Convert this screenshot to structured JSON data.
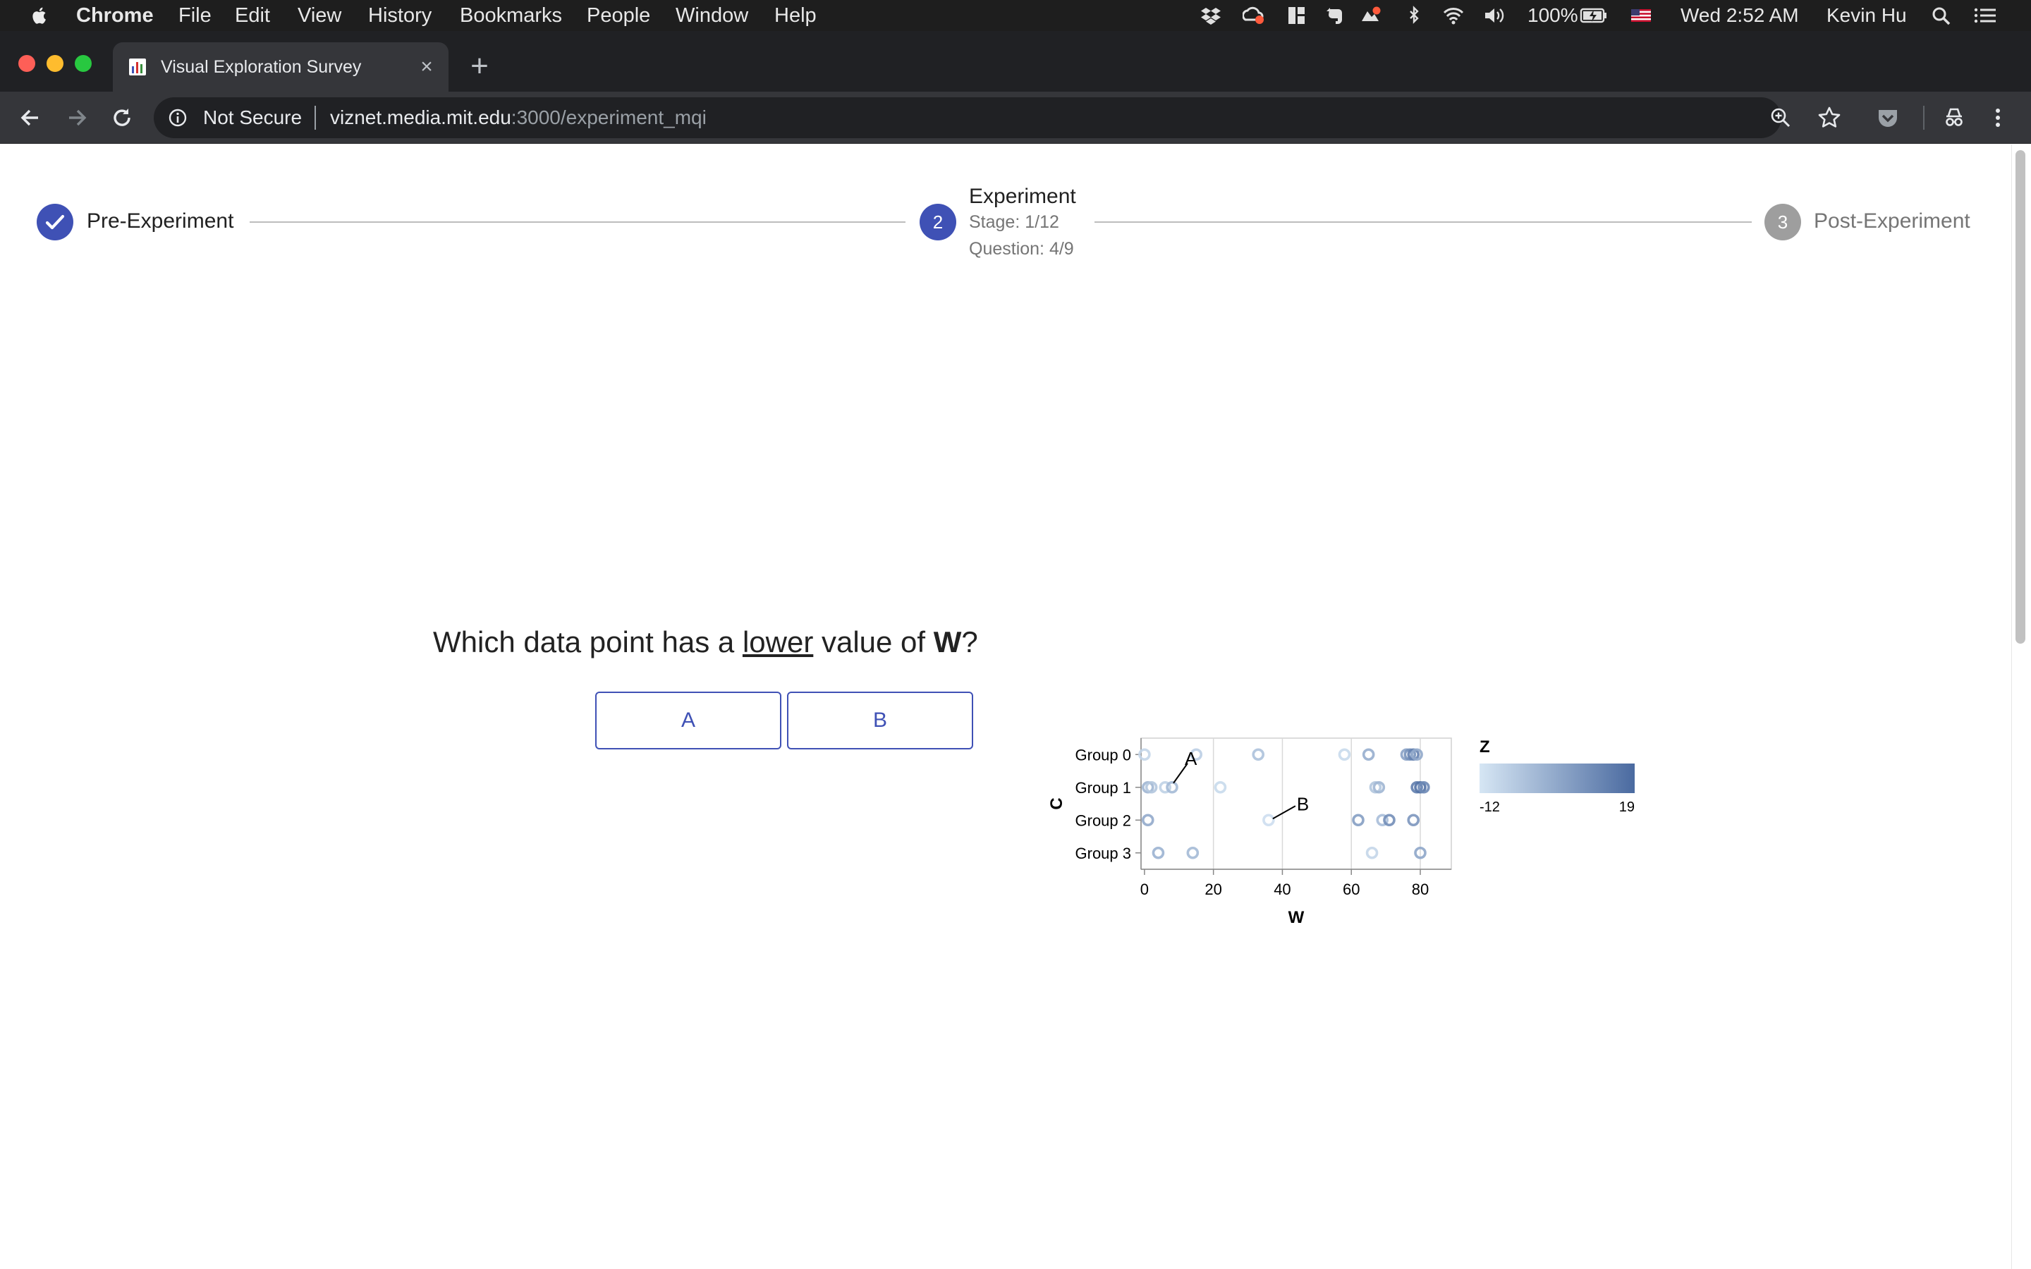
{
  "menubar": {
    "app": "Chrome",
    "items": [
      "File",
      "Edit",
      "View",
      "History",
      "Bookmarks",
      "People",
      "Window",
      "Help"
    ],
    "battery": "100%",
    "datetime": "Wed 2:52 AM",
    "user": "Kevin Hu"
  },
  "browser": {
    "tab_title": "Visual Exploration Survey",
    "security_label": "Not Secure",
    "url_host": "viznet.media.mit.edu",
    "url_path": ":3000/experiment_mqi"
  },
  "stepper": {
    "step1": {
      "label": "Pre-Experiment",
      "state": "completed"
    },
    "step2": {
      "number": "2",
      "label": "Experiment",
      "stage": "Stage: 1/12",
      "question": "Question: 4/9",
      "state": "active"
    },
    "step3": {
      "number": "3",
      "label": "Post-Experiment",
      "state": "pending"
    }
  },
  "question": {
    "prefix": "Which data point has a ",
    "emphasis": "lower",
    "middle": " value of ",
    "variable": "W",
    "suffix": "?",
    "options": [
      "A",
      "B"
    ]
  },
  "colors": {
    "accent": "#3f51b5",
    "color_low": "#d6e6f4",
    "color_high": "#4a6aa0"
  },
  "chart_data": {
    "type": "scatter",
    "xlabel": "W",
    "ylabel": "C",
    "xlim": [
      -1,
      89
    ],
    "xticks": [
      0,
      20,
      40,
      60,
      80
    ],
    "categories": [
      "Group 0",
      "Group 1",
      "Group 2",
      "Group 3"
    ],
    "color_legend": {
      "title": "Z",
      "min_label": "-12",
      "max_label": "19",
      "min": -12,
      "max": 19
    },
    "grid": "vertical",
    "points": [
      {
        "x": 0,
        "c": 0,
        "z": -8
      },
      {
        "x": 15,
        "c": 0,
        "z": -6
      },
      {
        "x": 33,
        "c": 0,
        "z": -3
      },
      {
        "x": 58,
        "c": 0,
        "z": -9
      },
      {
        "x": 65,
        "c": 0,
        "z": 2
      },
      {
        "x": 76,
        "c": 0,
        "z": 5
      },
      {
        "x": 77,
        "c": 0,
        "z": 9
      },
      {
        "x": 78,
        "c": 0,
        "z": 13
      },
      {
        "x": 79,
        "c": 0,
        "z": 3
      },
      {
        "x": 1,
        "c": 1,
        "z": 0
      },
      {
        "x": 2,
        "c": 1,
        "z": -4
      },
      {
        "x": 6,
        "c": 1,
        "z": -7
      },
      {
        "x": 8,
        "c": 1,
        "z": -1
      },
      {
        "x": 22,
        "c": 1,
        "z": -9
      },
      {
        "x": 67,
        "c": 1,
        "z": -4
      },
      {
        "x": 68,
        "c": 1,
        "z": 0
      },
      {
        "x": 79,
        "c": 1,
        "z": 14
      },
      {
        "x": 80,
        "c": 1,
        "z": 17
      },
      {
        "x": 81,
        "c": 1,
        "z": 11
      },
      {
        "x": 1,
        "c": 2,
        "z": 3
      },
      {
        "x": 36,
        "c": 2,
        "z": -10
      },
      {
        "x": 62,
        "c": 2,
        "z": 6
      },
      {
        "x": 69,
        "c": 2,
        "z": -2
      },
      {
        "x": 71,
        "c": 2,
        "z": 10
      },
      {
        "x": 78,
        "c": 2,
        "z": 8
      },
      {
        "x": 4,
        "c": 3,
        "z": 1
      },
      {
        "x": 14,
        "c": 3,
        "z": -1
      },
      {
        "x": 66,
        "c": 3,
        "z": -8
      },
      {
        "x": 80,
        "c": 3,
        "z": 4
      }
    ],
    "annotations": [
      {
        "label": "A",
        "x": 8,
        "c": 1
      },
      {
        "label": "B",
        "x": 36,
        "c": 2
      }
    ]
  }
}
